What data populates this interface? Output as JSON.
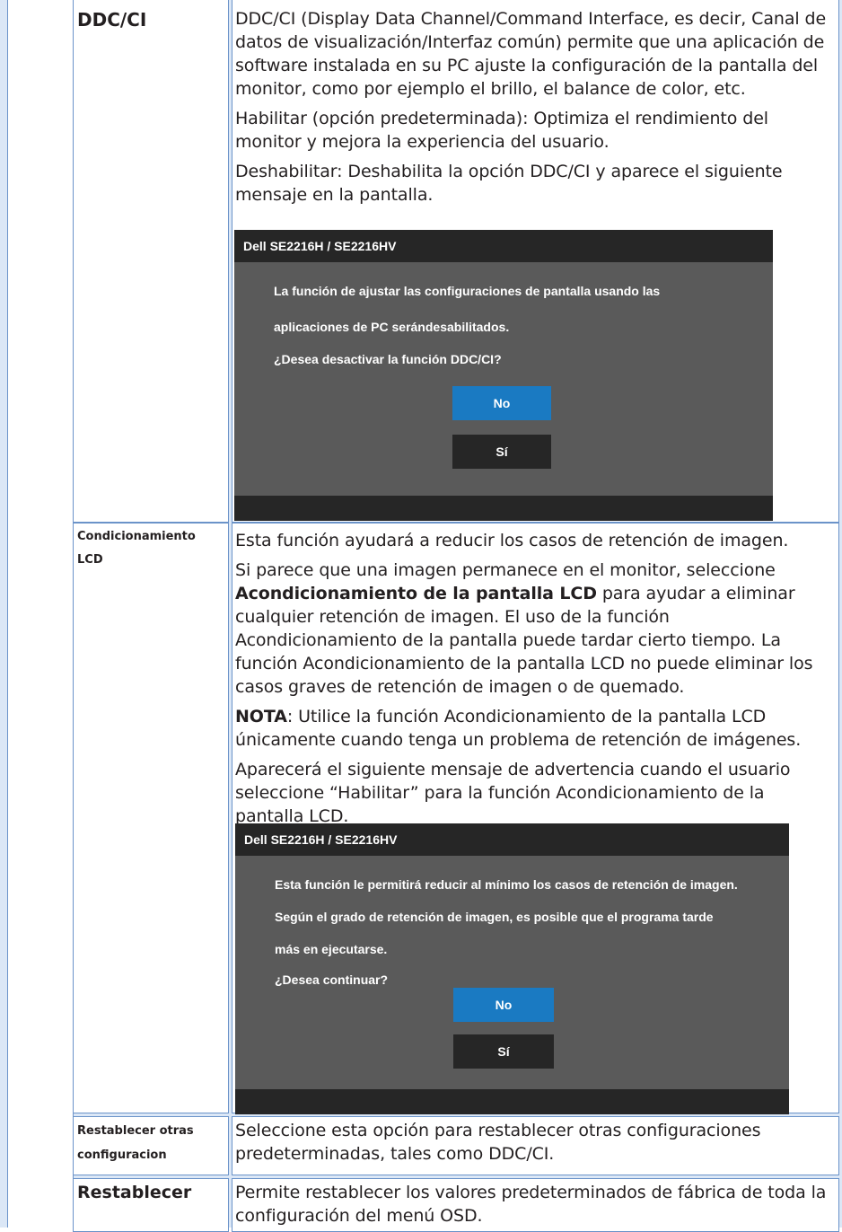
{
  "rows": {
    "ddc": {
      "label": "DDC/CI",
      "p1": "DDC/CI (Display Data Channel/Command Interface, es decir, Canal de datos de visualización/Interfaz común) permite que una aplicación de software instalada en su PC ajuste la configuración de la pantalla del monitor, como por ejemplo el brillo, el balance de color, etc.",
      "p2": "Habilitar (opción predeterminada): Optimiza el rendimiento del monitor y mejora la experiencia del usuario.",
      "p3": "Deshabilitar: Deshabilita la opción DDC/CI y aparece el siguiente mensaje en la pantalla.",
      "osd": {
        "title": "Dell SE2216H / SE2216HV",
        "line1": "La función de ajustar las configuraciones de pantalla usando las",
        "line2": "aplicaciones de PC serándesabilitados.",
        "line3": "¿Desea desactivar la función DDC/CI?",
        "no": "No",
        "si": "Sí"
      }
    },
    "lcd": {
      "label": "Condicionamiento LCD",
      "p1": "Esta función ayudará a reducir los casos de retención de imagen.",
      "p2_pre": "Si parece que una imagen permanece en el monitor, seleccione ",
      "p2_bold": "Acondicionamiento de la pantalla LCD",
      "p2_post": " para ayudar a eliminar cualquier retención de imagen. El uso de la función Acondicionamiento de la pantalla puede tardar cierto tiempo. La función Acondicionamiento de la pantalla LCD no puede eliminar los casos graves de retención de imagen o de quemado.",
      "note_bold": "NOTA",
      "note_text": ": Utilice la función Acondicionamiento de la pantalla LCD únicamente cuando tenga un problema de retención de imágenes.",
      "p4": "Aparecerá el siguiente mensaje de advertencia cuando el usuario seleccione “Habilitar” para la función Acondicionamiento de la pantalla LCD.",
      "osd": {
        "title": "Dell SE2216H / SE2216HV",
        "line1": "Esta función le permitirá reducir al mínimo los casos de retención de imagen.",
        "line2": "Según el grado de retención de imagen, es posible que el programa tarde",
        "line3": "más en ejecutarse.",
        "line4": "¿Desea continuar?",
        "no": "No",
        "si": "Sí"
      }
    },
    "reset_other": {
      "label": "Restablecer otras configuracion",
      "desc": "Seleccione esta opción para restablecer otras configuraciones predeterminadas, tales como DDC/CI."
    },
    "reset": {
      "label": "Restablecer",
      "desc": "Permite restablecer los valores predeterminados de fábrica de toda la configuración del menú OSD."
    }
  }
}
